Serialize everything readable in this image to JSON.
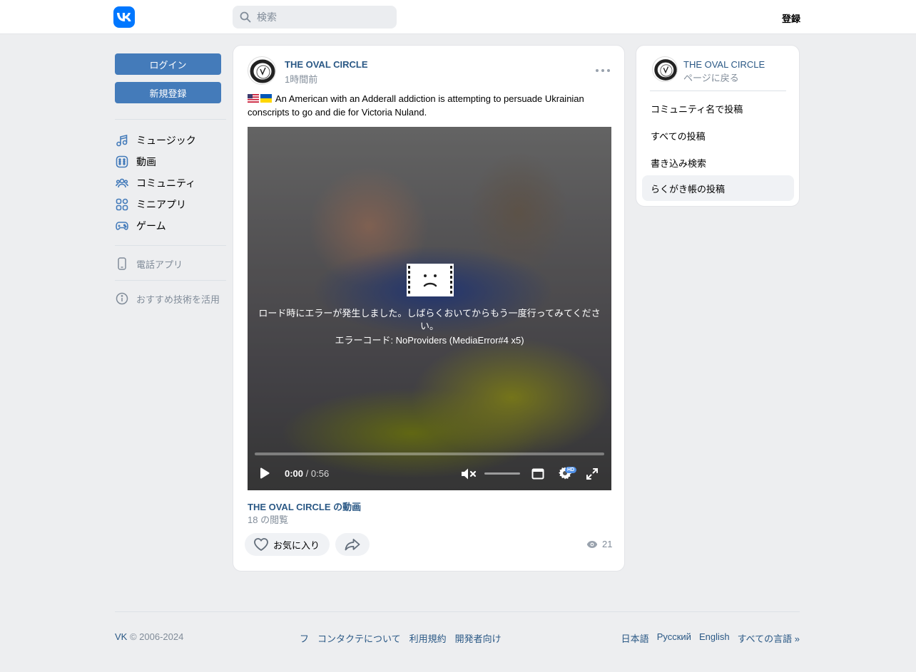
{
  "header": {
    "search_placeholder": "検索",
    "register_label": "登録"
  },
  "left_nav": {
    "login_label": "ログイン",
    "signup_label": "新規登録",
    "items": [
      {
        "label": "ミュージック",
        "icon": "music-icon"
      },
      {
        "label": "動画",
        "icon": "video-icon"
      },
      {
        "label": "コミュニティ",
        "icon": "community-icon"
      },
      {
        "label": "ミニアプリ",
        "icon": "mini-apps-icon"
      },
      {
        "label": "ゲーム",
        "icon": "gamepad-icon"
      }
    ],
    "phone_app_label": "電話アプリ",
    "tech_label": "おすすめ技術を活用"
  },
  "post": {
    "author": "THE OVAL CIRCLE",
    "time": "1時間前",
    "text": "An American with an Adderall addiction is attempting to persuade Ukrainian conscripts to go and die for Victoria Nuland.",
    "video": {
      "error_message": "ロード時にエラーが発生しました。しばらくおいてからもう一度行ってみてください。",
      "error_code": "エラーコード: NoProviders (MediaError#4 x5)",
      "current_time": "0:00",
      "duration": "/ 0:56",
      "quality_badge": "HD",
      "progress": 0
    },
    "video_title": "THE OVAL CIRCLE の動画",
    "video_views": "18 の閲覧",
    "like_label": "お気に入り",
    "views_count": "21"
  },
  "side_card": {
    "title": "THE OVAL CIRCLE",
    "subtitle": "ページに戻る",
    "items": [
      {
        "label": "コミュニティ名で投稿",
        "active": false
      },
      {
        "label": "すべての投稿",
        "active": false
      },
      {
        "label": "書き込み検索",
        "active": false
      },
      {
        "label": "らくがき帳の投稿",
        "active": true
      }
    ]
  },
  "footer": {
    "brand": "VK",
    "copyright": "© 2006-2024",
    "links": [
      "フ",
      "コンタクテについて",
      "利用規約",
      "開発者向け"
    ],
    "languages": [
      "日本語",
      "Русский",
      "English",
      "すべての言語 »"
    ]
  },
  "colors": {
    "brand_blue": "#0077ff",
    "button_blue": "#447bba",
    "link_blue": "#2a5885",
    "muted": "#818c99"
  }
}
